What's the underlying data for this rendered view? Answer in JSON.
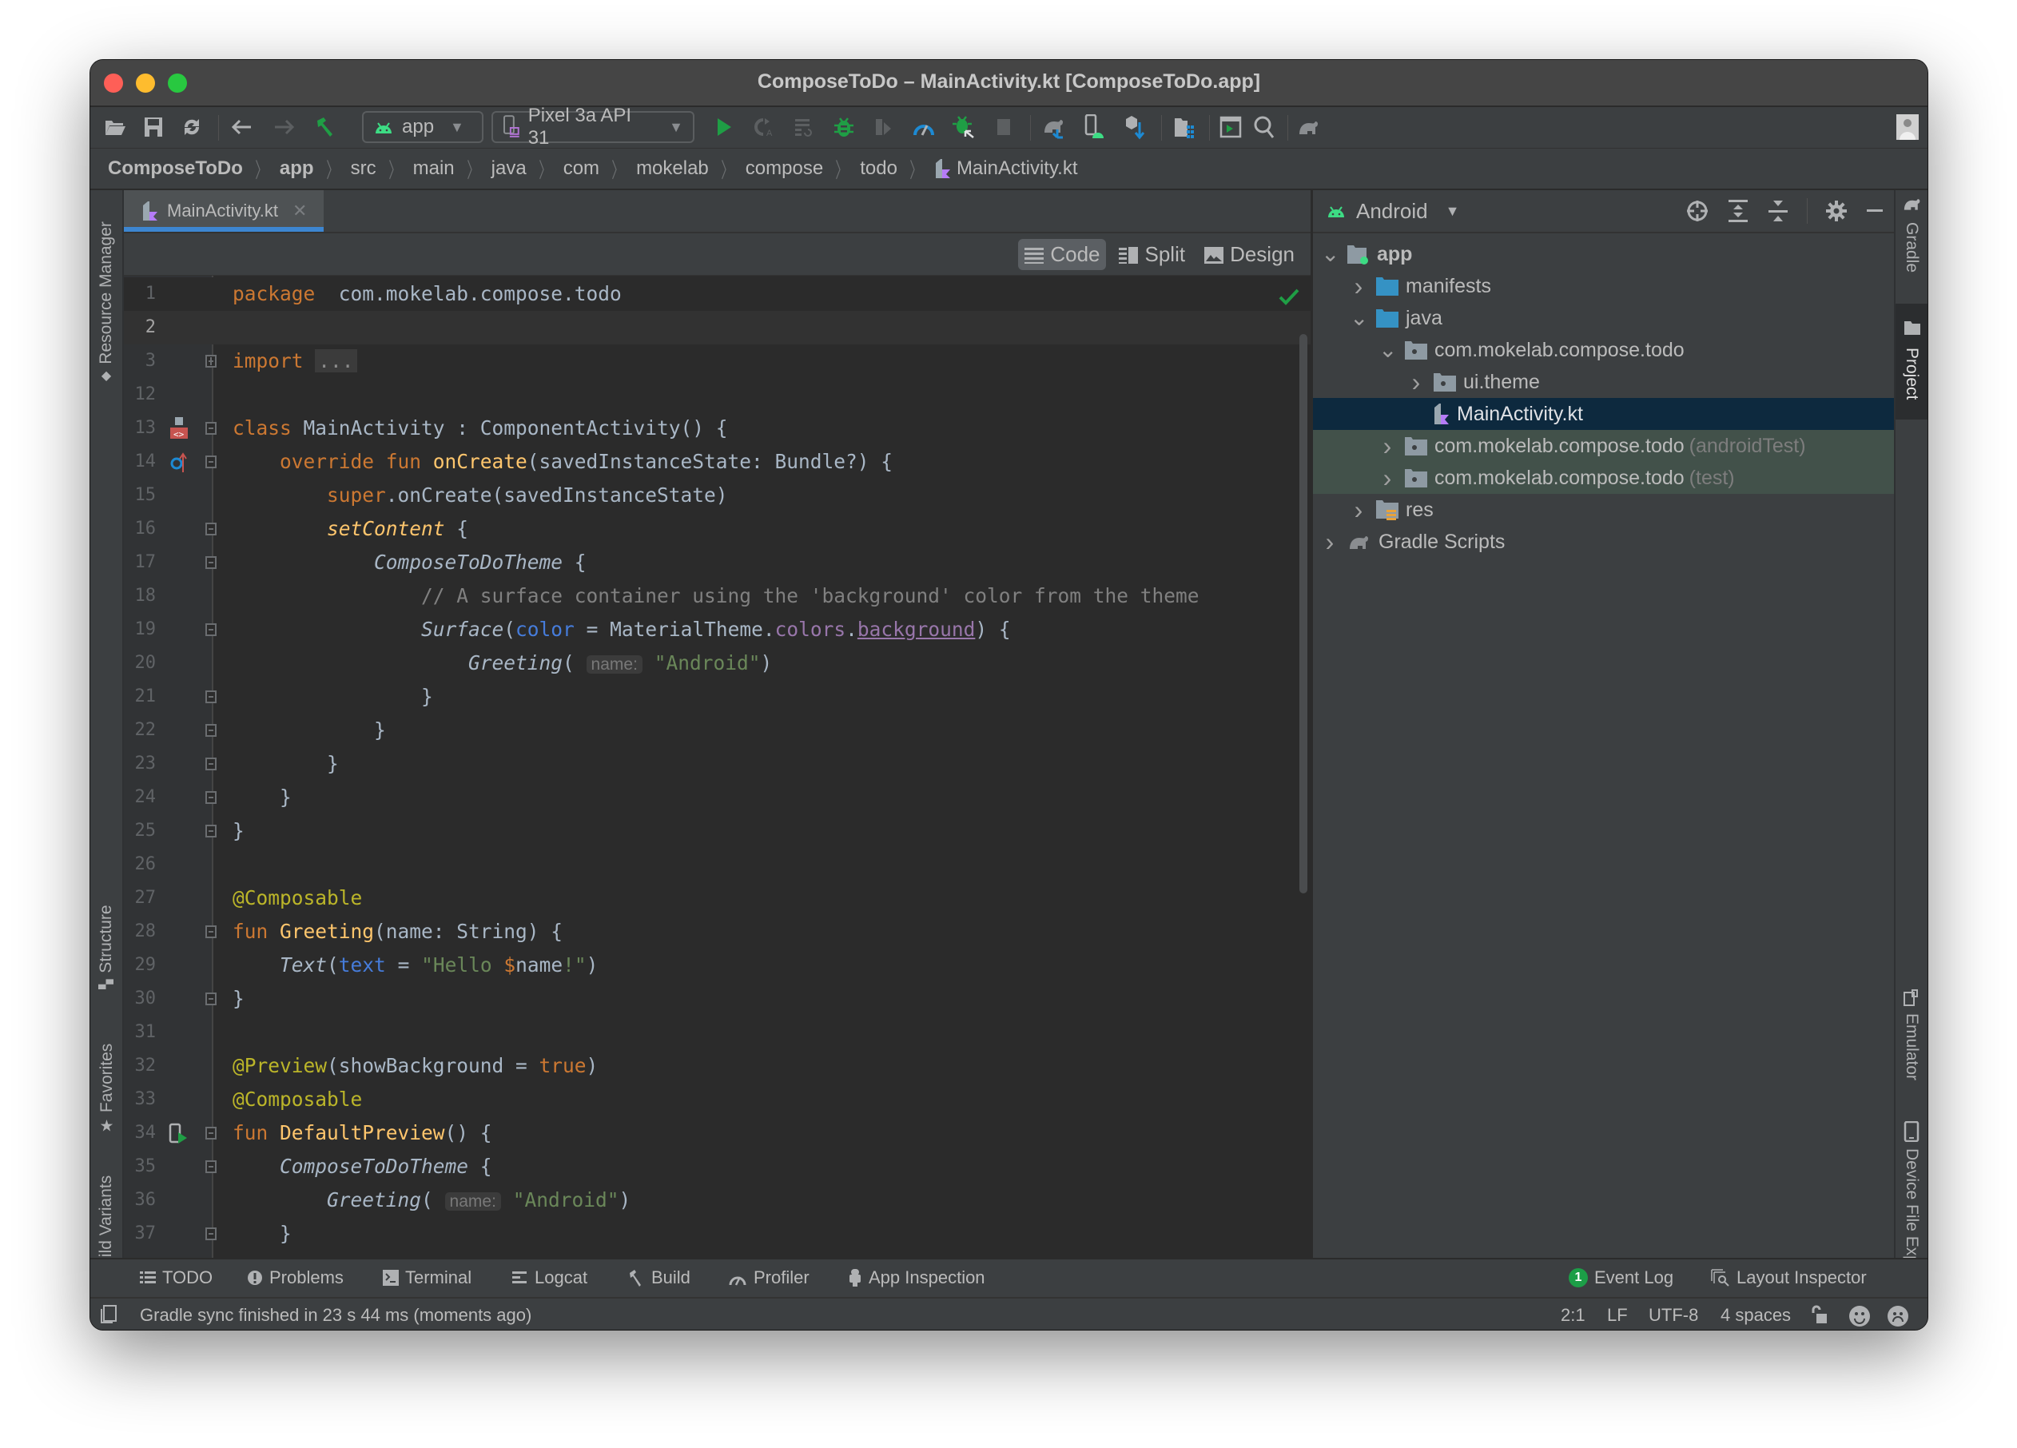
{
  "window": {
    "title": "ComposeToDo – MainActivity.kt [ComposeToDo.app]"
  },
  "toolbar": {
    "run_config": "app",
    "device": "Pixel 3a API 31",
    "icons": [
      "open-folder-icon",
      "save-icon",
      "sync-icon",
      "back-icon",
      "forward-icon",
      "build-hammer-icon",
      "run-icon",
      "apply-changes-icon",
      "apply-code-changes-icon",
      "debug-icon",
      "attach-icon",
      "profile-icon",
      "attach-debugger-icon",
      "stop-icon",
      "gradle-sync-icon",
      "avd-manager-icon",
      "sdk-manager-icon",
      "project-structure-icon",
      "terminal-run-icon",
      "search-icon",
      "gradle-icon",
      "user-avatar-icon"
    ]
  },
  "breadcrumb": [
    "ComposeToDo",
    "app",
    "src",
    "main",
    "java",
    "com",
    "mokelab",
    "compose",
    "todo",
    "MainActivity.kt"
  ],
  "left_stripe": {
    "resource_manager": "Resource Manager",
    "structure": "Structure",
    "favorites": "Favorites",
    "build_variants": "Build Variants"
  },
  "right_stripe": {
    "gradle": "Gradle",
    "project": "Project",
    "emulator": "Emulator",
    "device_file_explorer": "Device File Explorer"
  },
  "editor": {
    "tab": "MainActivity.kt",
    "modes": [
      "Code",
      "Split",
      "Design"
    ],
    "active_mode": "Code",
    "lines": [
      {
        "n": "1",
        "tokens": [
          [
            "kw",
            "package"
          ],
          [
            "",
            "  com.mokelab.compose.todo"
          ]
        ]
      },
      {
        "n": "2",
        "tokens": []
      },
      {
        "n": "3",
        "tokens": [
          [
            "kw",
            "import"
          ],
          [
            "",
            " "
          ],
          [
            "folded",
            "..."
          ]
        ]
      },
      {
        "n": "12",
        "tokens": []
      },
      {
        "n": "13",
        "tokens": [
          [
            "kw",
            "class"
          ],
          [
            "",
            " MainActivity : ComponentActivity() {"
          ]
        ]
      },
      {
        "n": "14",
        "tokens": [
          [
            "",
            "    "
          ],
          [
            "kw",
            "override fun "
          ],
          [
            "fn",
            "onCreate"
          ],
          [
            "",
            "(savedInstanceState: Bundle?) {"
          ]
        ]
      },
      {
        "n": "15",
        "tokens": [
          [
            "",
            "        "
          ],
          [
            "kw",
            "super"
          ],
          [
            "",
            ".onCreate(savedInstanceState)"
          ]
        ]
      },
      {
        "n": "16",
        "tokens": [
          [
            "",
            "        "
          ],
          [
            "fn it",
            "setContent"
          ],
          [
            "",
            " {"
          ]
        ]
      },
      {
        "n": "17",
        "tokens": [
          [
            "",
            "            "
          ],
          [
            "it",
            "ComposeToDoTheme"
          ],
          [
            "",
            " {"
          ]
        ]
      },
      {
        "n": "18",
        "tokens": [
          [
            "",
            "                "
          ],
          [
            "cmt",
            "// A surface container using the 'background' color from the theme"
          ]
        ]
      },
      {
        "n": "19",
        "tokens": [
          [
            "",
            "                "
          ],
          [
            "it",
            "Surface"
          ],
          [
            "",
            "("
          ],
          [
            "param",
            "color"
          ],
          [
            "",
            " = MaterialTheme."
          ],
          [
            "prop",
            "colors"
          ],
          [
            "",
            "."
          ],
          [
            "prop-u",
            "background"
          ],
          [
            "",
            ") {"
          ]
        ]
      },
      {
        "n": "20",
        "tokens": [
          [
            "",
            "                    "
          ],
          [
            "it",
            "Greeting"
          ],
          [
            "",
            "( "
          ],
          [
            "hint",
            "name:"
          ],
          [
            "",
            " "
          ],
          [
            "str",
            "\"Android\""
          ],
          [
            "",
            ")"
          ]
        ]
      },
      {
        "n": "21",
        "tokens": [
          [
            "",
            "                }"
          ]
        ]
      },
      {
        "n": "22",
        "tokens": [
          [
            "",
            "            }"
          ]
        ]
      },
      {
        "n": "23",
        "tokens": [
          [
            "",
            "        }"
          ]
        ]
      },
      {
        "n": "24",
        "tokens": [
          [
            "",
            "    }"
          ]
        ]
      },
      {
        "n": "25",
        "tokens": [
          [
            "",
            "}"
          ]
        ]
      },
      {
        "n": "26",
        "tokens": []
      },
      {
        "n": "27",
        "tokens": [
          [
            "ann",
            "@Composable"
          ]
        ]
      },
      {
        "n": "28",
        "tokens": [
          [
            "kw",
            "fun "
          ],
          [
            "fn",
            "Greeting"
          ],
          [
            "",
            "(name: String) {"
          ]
        ]
      },
      {
        "n": "29",
        "tokens": [
          [
            "",
            "    "
          ],
          [
            "it",
            "Text"
          ],
          [
            "",
            "("
          ],
          [
            "param",
            "text"
          ],
          [
            "",
            " = "
          ],
          [
            "str",
            "\"Hello "
          ],
          [
            "kw",
            "$"
          ],
          [
            "",
            "name"
          ],
          [
            "str",
            "!\""
          ],
          [
            "",
            ")"
          ]
        ]
      },
      {
        "n": "30",
        "tokens": [
          [
            "",
            "}"
          ]
        ]
      },
      {
        "n": "31",
        "tokens": []
      },
      {
        "n": "32",
        "tokens": [
          [
            "ann",
            "@Preview"
          ],
          [
            "",
            "(showBackground = "
          ],
          [
            "kw",
            "true"
          ],
          [
            "",
            ")"
          ]
        ]
      },
      {
        "n": "33",
        "tokens": [
          [
            "ann",
            "@Composable"
          ]
        ]
      },
      {
        "n": "34",
        "tokens": [
          [
            "kw",
            "fun "
          ],
          [
            "fn",
            "DefaultPreview"
          ],
          [
            "",
            "() {"
          ]
        ]
      },
      {
        "n": "35",
        "tokens": [
          [
            "",
            "    "
          ],
          [
            "it",
            "ComposeToDoTheme"
          ],
          [
            "",
            " {"
          ]
        ]
      },
      {
        "n": "36",
        "tokens": [
          [
            "",
            "        "
          ],
          [
            "it",
            "Greeting"
          ],
          [
            "",
            "( "
          ],
          [
            "hint",
            "name:"
          ],
          [
            "",
            " "
          ],
          [
            "str",
            "\"Android\""
          ],
          [
            "",
            ")"
          ]
        ]
      },
      {
        "n": "37",
        "tokens": [
          [
            "",
            "    }"
          ]
        ]
      }
    ]
  },
  "project": {
    "view": "Android",
    "tree": [
      {
        "label": "app",
        "depth": 0,
        "arrow": "down",
        "icon": "module",
        "bold": true
      },
      {
        "label": "manifests",
        "depth": 1,
        "arrow": "right",
        "icon": "folder-blue"
      },
      {
        "label": "java",
        "depth": 1,
        "arrow": "down",
        "icon": "folder-blue"
      },
      {
        "label": "com.mokelab.compose.todo",
        "depth": 2,
        "arrow": "down",
        "icon": "package"
      },
      {
        "label": "ui.theme",
        "depth": 3,
        "arrow": "right",
        "icon": "package"
      },
      {
        "label": "MainActivity.kt",
        "depth": 3,
        "arrow": "none",
        "icon": "kotlin",
        "selected": true
      },
      {
        "label": "com.mokelab.compose.todo",
        "suffix": "(androidTest)",
        "depth": 2,
        "arrow": "right",
        "icon": "package",
        "test": true
      },
      {
        "label": "com.mokelab.compose.todo",
        "suffix": "(test)",
        "depth": 2,
        "arrow": "right",
        "icon": "package",
        "test": true
      },
      {
        "label": "res",
        "depth": 1,
        "arrow": "right",
        "icon": "res"
      },
      {
        "label": "Gradle Scripts",
        "depth": 0,
        "arrow": "right",
        "icon": "gradle"
      }
    ]
  },
  "tool_windows": {
    "left": [
      "TODO",
      "Problems",
      "Terminal",
      "Logcat",
      "Build",
      "Profiler",
      "App Inspection"
    ],
    "event_log": "Event Log",
    "event_log_count": "1",
    "layout_inspector": "Layout Inspector"
  },
  "status": {
    "message": "Gradle sync finished in 23 s 44 ms (moments ago)",
    "position": "2:1",
    "line_sep": "LF",
    "encoding": "UTF-8",
    "indent": "4 spaces"
  },
  "colors": {
    "accent": "#3d86d1",
    "android_green": "#3ddc84",
    "run_green": "#1f9e45",
    "selected_row": "#0d293e",
    "test_row": "#42514a"
  }
}
